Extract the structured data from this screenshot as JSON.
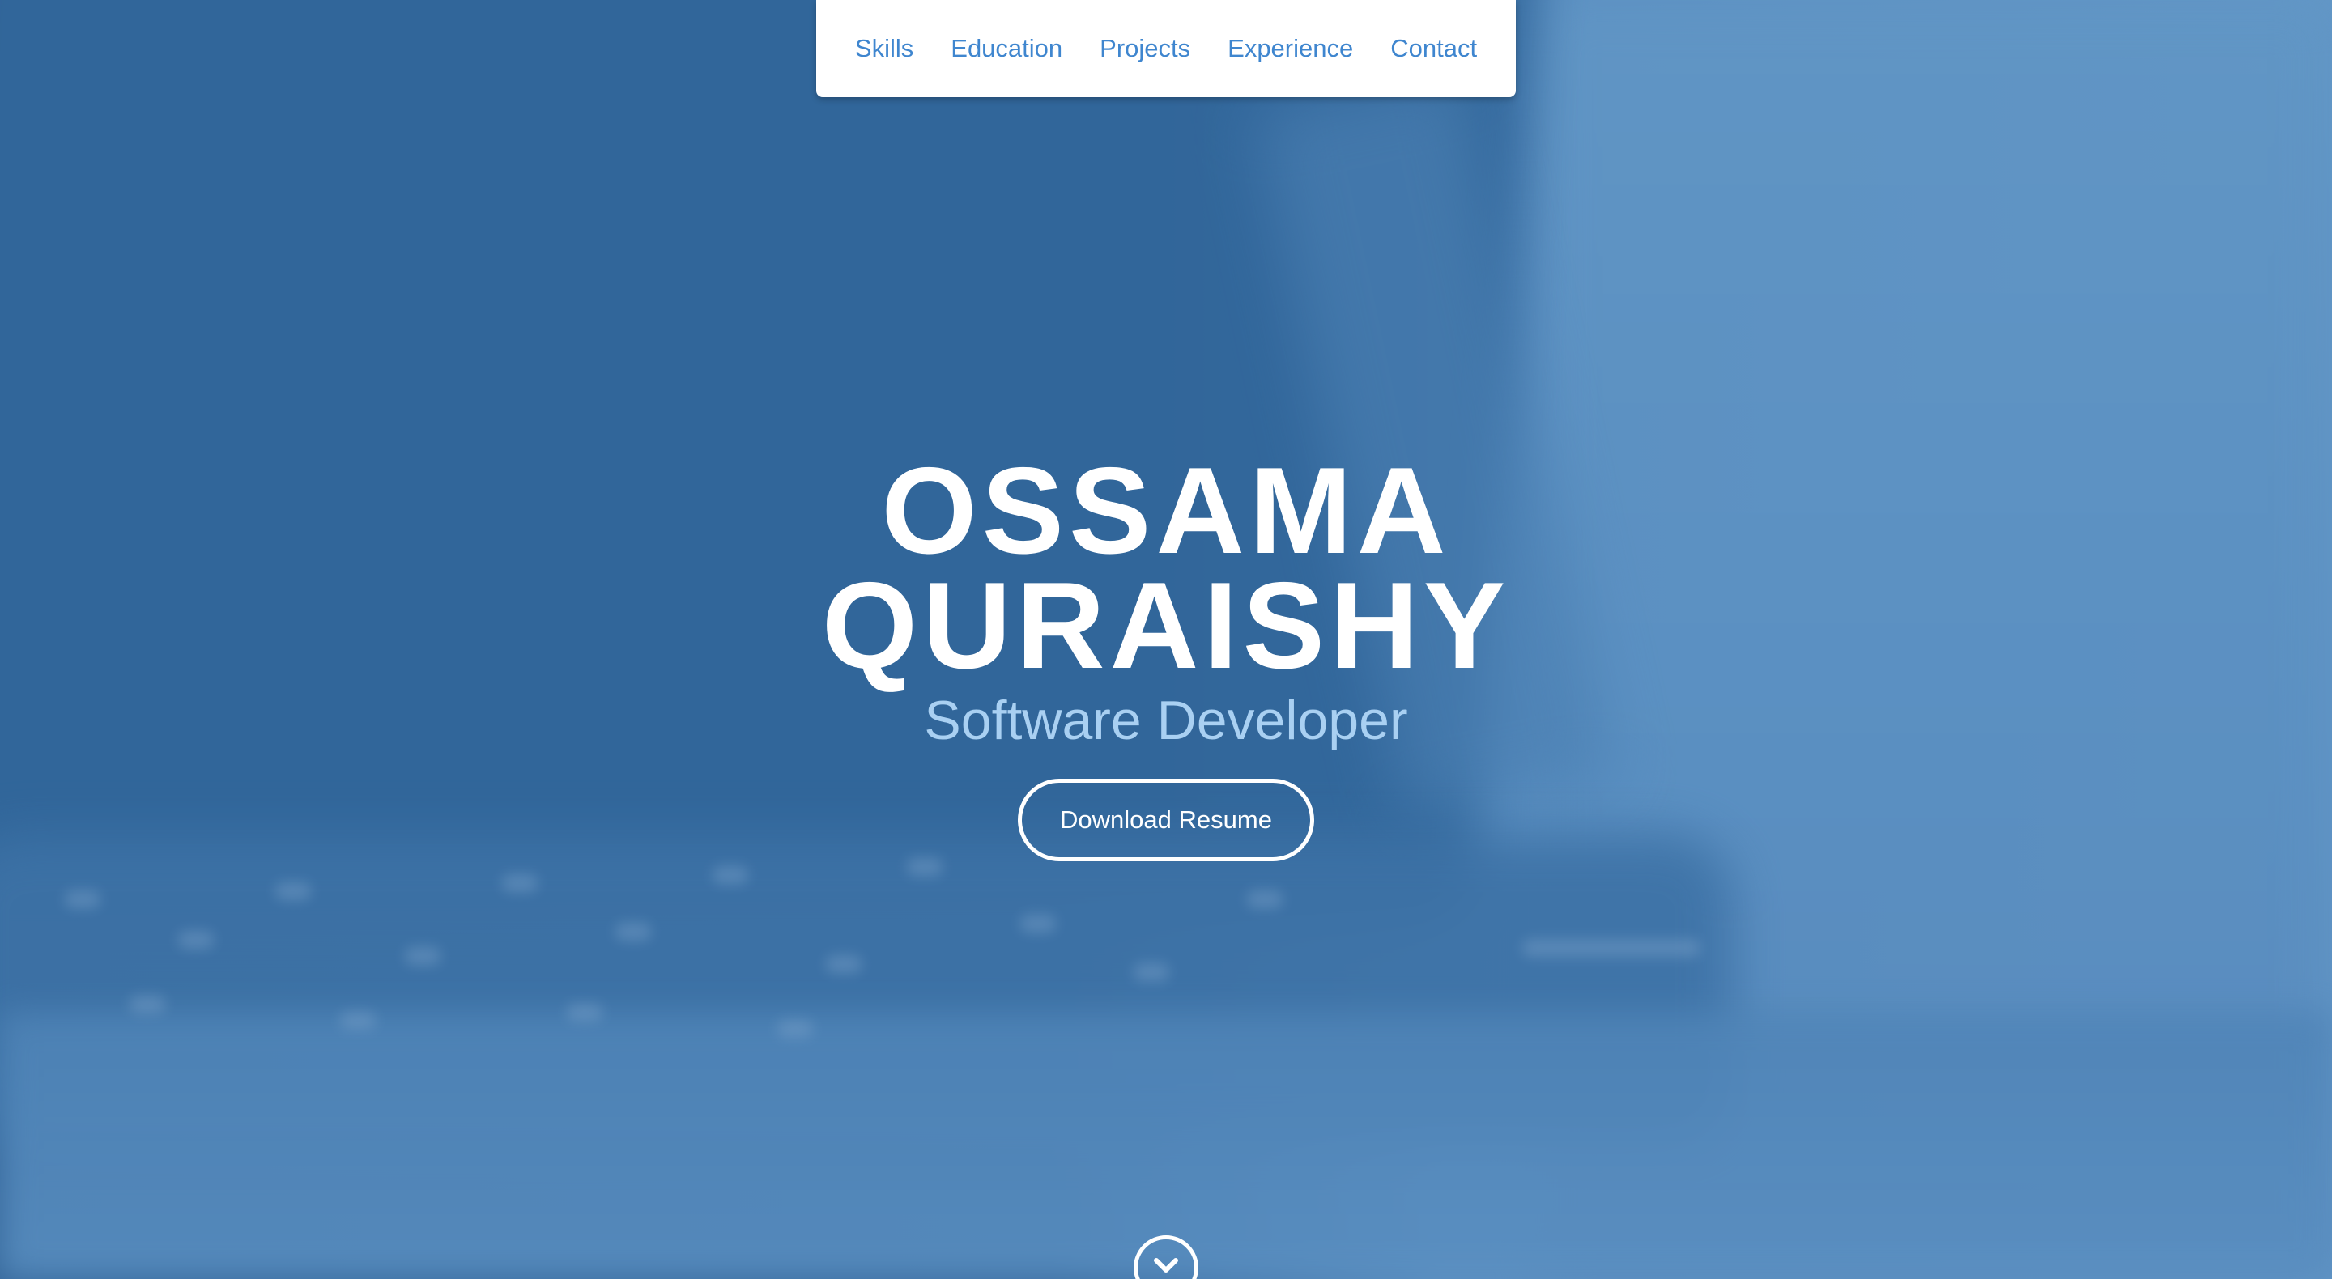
{
  "nav": {
    "items": [
      {
        "label": "Skills"
      },
      {
        "label": "Education"
      },
      {
        "label": "Projects"
      },
      {
        "label": "Experience"
      },
      {
        "label": "Contact"
      }
    ]
  },
  "hero": {
    "name_line_1": "OSSAMA",
    "name_line_2": "QURAISHY",
    "subtitle": "Software Developer",
    "button_label": "Download Resume",
    "scroll_icon": "chevron-down-icon"
  },
  "colors": {
    "overlay": "#4d80b4",
    "nav_background": "#ffffff",
    "nav_link": "#3f86cf",
    "name_text": "#ffffff",
    "subtitle_text": "#a9d0f2"
  }
}
